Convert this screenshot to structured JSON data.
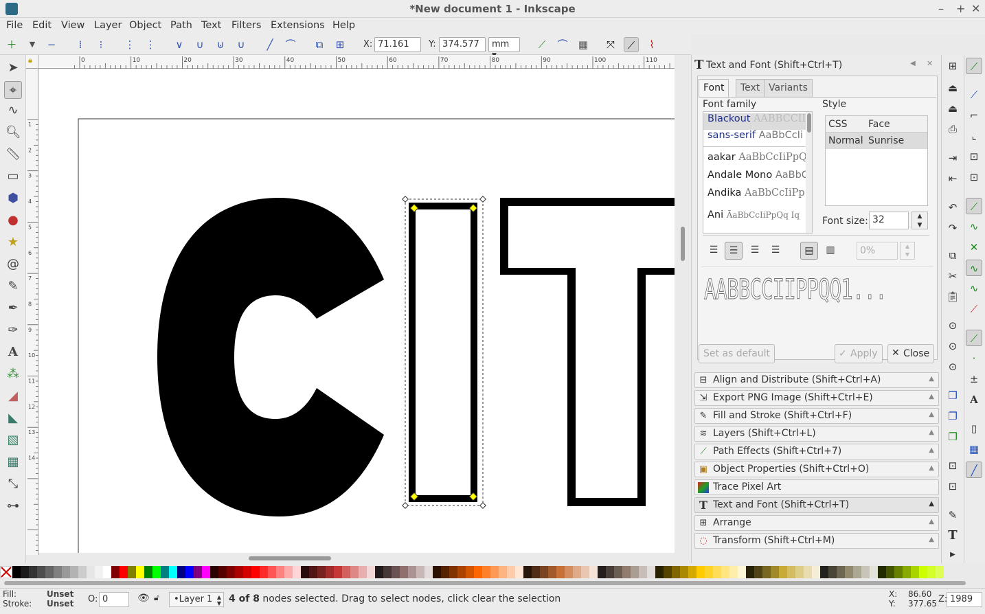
{
  "window": {
    "title": "*New document 1 - Inkscape",
    "controls": [
      "–",
      "+",
      "✕"
    ]
  },
  "menu": [
    "File",
    "Edit",
    "View",
    "Layer",
    "Object",
    "Path",
    "Text",
    "Filters",
    "Extensions",
    "Help"
  ],
  "node_toolbar": {
    "x_label": "X:",
    "x_value": "71.161",
    "y_label": "Y:",
    "y_value": "374.577",
    "unit": "mm"
  },
  "ruler": {
    "h_ticks": [
      "0",
      "10",
      "20",
      "30",
      "40",
      "50",
      "60",
      "70",
      "80",
      "90",
      "100",
      "110"
    ],
    "v_ticks": [
      "1",
      "2",
      "3",
      "4",
      "5",
      "6",
      "7",
      "8",
      "9",
      "10",
      "11",
      "12",
      "13",
      "14"
    ]
  },
  "canvas": {
    "text": "CIT"
  },
  "text_font_dialog": {
    "title": "Text and Font (Shift+Ctrl+T)",
    "tabs": [
      "Font",
      "Text",
      "Variants"
    ],
    "font_family_label": "Font family",
    "fonts": [
      {
        "name": "Blackout",
        "preview": "AABBCCIIPPQQ"
      },
      {
        "name": "sans-serif",
        "preview": "AaBbCcIi"
      },
      {
        "name": "aakar",
        "preview": "AaBbCcIiPpQq"
      },
      {
        "name": "Andale Mono",
        "preview": "AaBbCc"
      },
      {
        "name": "Andika",
        "preview": "AaBbCcIiPp"
      },
      {
        "name": "Ani",
        "preview": "ĀaBbCcIiPpQq Iq"
      }
    ],
    "style_label": "Style",
    "style_headers": [
      "CSS",
      "Face"
    ],
    "style_row": [
      "Normal",
      "Sunrise"
    ],
    "font_size_label": "Font size:",
    "font_size": "32",
    "spacing": "0%",
    "preview": "AABBCCIIPPQQ1...",
    "set_default": "Set as default",
    "apply": "Apply",
    "close": "Close"
  },
  "docked_dialogs": [
    "Align and Distribute (Shift+Ctrl+A)",
    "Export PNG Image (Shift+Ctrl+E)",
    "Fill and Stroke (Shift+Ctrl+F)",
    "Layers (Shift+Ctrl+L)",
    "Path Effects  (Shift+Ctrl+7)",
    "Object Properties (Shift+Ctrl+O)",
    "Trace Pixel Art",
    "Text and Font (Shift+Ctrl+T)",
    "Arrange",
    "Transform (Shift+Ctrl+M)"
  ],
  "status": {
    "fill_label": "Fill:",
    "fill_value": "Unset",
    "stroke_label": "Stroke:",
    "stroke_value": "Unset",
    "opacity_label": "O:",
    "opacity_value": "0",
    "layer": "•Layer 1",
    "message_bold": "4 of 8",
    "message": " nodes selected. Drag to select nodes, click clear the selection",
    "x_label": "X:",
    "x": "86.60",
    "y_label": "Y:",
    "y": "377.65",
    "zoom_label": "Z:",
    "zoom": "1989"
  },
  "colors": {
    "accent": "#2050c0",
    "selected_font_bg": "#dcdcdc"
  }
}
